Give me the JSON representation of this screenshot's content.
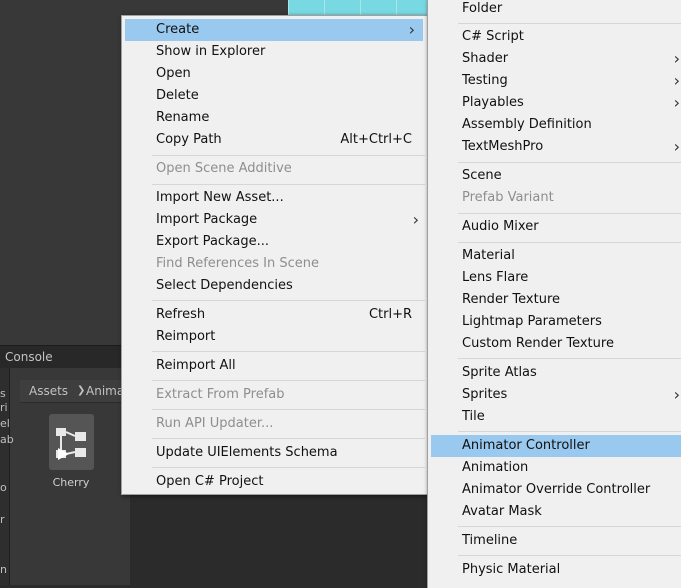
{
  "background": {
    "console_tab": "Console",
    "left_tree_text": [
      "s",
      "ri",
      "el",
      "ab",
      "o",
      "r",
      "n"
    ],
    "breadcrumb": [
      "Assets",
      "Anima"
    ],
    "asset_name": "Cherry"
  },
  "context_menu": {
    "items": [
      {
        "label": "Create",
        "submenu": true,
        "highlighted": true
      },
      {
        "label": "Show in Explorer"
      },
      {
        "label": "Open"
      },
      {
        "label": "Delete"
      },
      {
        "label": "Rename"
      },
      {
        "label": "Copy Path",
        "shortcut": "Alt+Ctrl+C"
      },
      {
        "label": "Open Scene Additive",
        "disabled": true
      },
      {
        "label": "Import New Asset..."
      },
      {
        "label": "Import Package",
        "submenu": true
      },
      {
        "label": "Export Package..."
      },
      {
        "label": "Find References In Scene",
        "disabled": true
      },
      {
        "label": "Select Dependencies"
      },
      {
        "label": "Refresh",
        "shortcut": "Ctrl+R"
      },
      {
        "label": "Reimport"
      },
      {
        "label": "Reimport All"
      },
      {
        "label": "Extract From Prefab",
        "disabled": true
      },
      {
        "label": "Run API Updater...",
        "disabled": true
      },
      {
        "label": "Update UIElements Schema"
      },
      {
        "label": "Open C# Project"
      }
    ]
  },
  "create_menu": {
    "items": [
      {
        "label": "Folder"
      },
      {
        "label": "C# Script"
      },
      {
        "label": "Shader",
        "submenu": true
      },
      {
        "label": "Testing",
        "submenu": true
      },
      {
        "label": "Playables",
        "submenu": true
      },
      {
        "label": "Assembly Definition"
      },
      {
        "label": "TextMeshPro",
        "submenu": true
      },
      {
        "label": "Scene"
      },
      {
        "label": "Prefab Variant",
        "disabled": true
      },
      {
        "label": "Audio Mixer"
      },
      {
        "label": "Material"
      },
      {
        "label": "Lens Flare"
      },
      {
        "label": "Render Texture"
      },
      {
        "label": "Lightmap Parameters"
      },
      {
        "label": "Custom Render Texture"
      },
      {
        "label": "Sprite Atlas"
      },
      {
        "label": "Sprites",
        "submenu": true
      },
      {
        "label": "Tile"
      },
      {
        "label": "Animator Controller",
        "highlighted": true
      },
      {
        "label": "Animation"
      },
      {
        "label": "Animator Override Controller"
      },
      {
        "label": "Avatar Mask"
      },
      {
        "label": "Timeline"
      },
      {
        "label": "Physic Material"
      }
    ]
  },
  "colors": {
    "menu_bg": "#f0f0f0",
    "highlight": "#99c9ef",
    "disabled_text": "#8e8e8e",
    "editor_bg": "#383838"
  }
}
